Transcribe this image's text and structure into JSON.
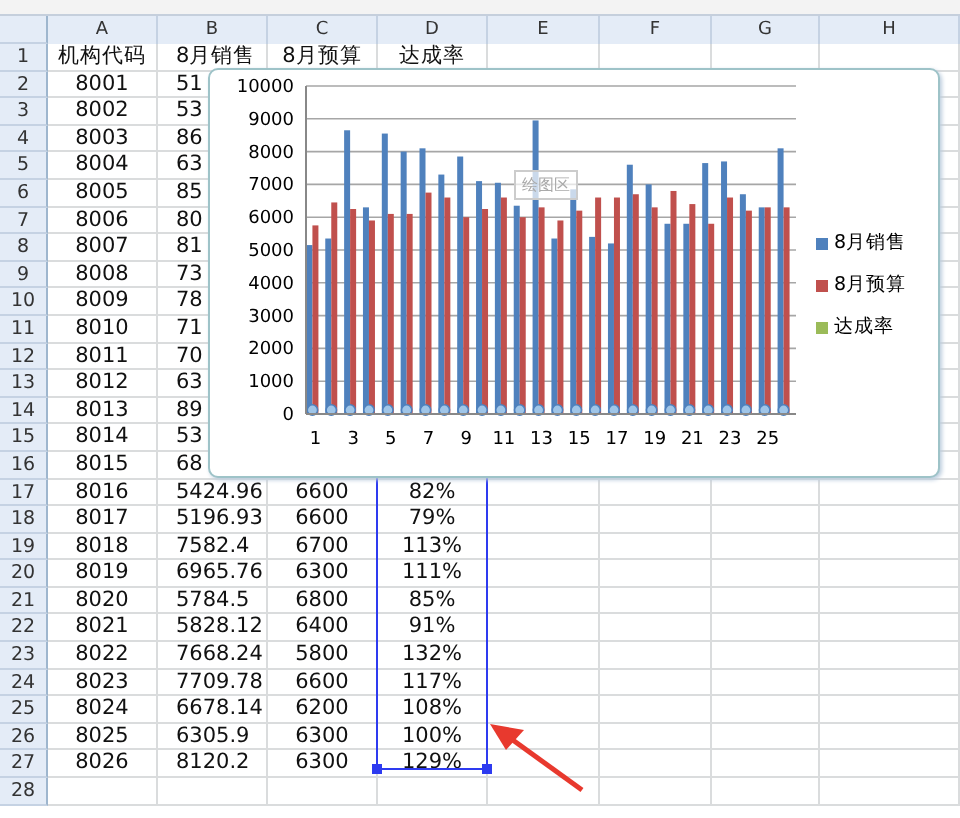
{
  "column_headers": [
    "A",
    "B",
    "C",
    "D",
    "E",
    "F",
    "G",
    "H"
  ],
  "rows": [
    {
      "num": "1",
      "cells": [
        "机构代码",
        "8月销售",
        "8月预算",
        "达成率"
      ]
    },
    {
      "num": "2",
      "cells": [
        "8001",
        "51"
      ]
    },
    {
      "num": "3",
      "cells": [
        "8002",
        "53"
      ]
    },
    {
      "num": "4",
      "cells": [
        "8003",
        "86"
      ]
    },
    {
      "num": "5",
      "cells": [
        "8004",
        "63"
      ]
    },
    {
      "num": "6",
      "cells": [
        "8005",
        "85"
      ]
    },
    {
      "num": "7",
      "cells": [
        "8006",
        "80"
      ]
    },
    {
      "num": "8",
      "cells": [
        "8007",
        "81"
      ]
    },
    {
      "num": "9",
      "cells": [
        "8008",
        "73"
      ]
    },
    {
      "num": "10",
      "cells": [
        "8009",
        "78"
      ]
    },
    {
      "num": "11",
      "cells": [
        "8010",
        "71"
      ]
    },
    {
      "num": "12",
      "cells": [
        "8011",
        "70"
      ]
    },
    {
      "num": "13",
      "cells": [
        "8012",
        "63"
      ]
    },
    {
      "num": "14",
      "cells": [
        "8013",
        "89"
      ]
    },
    {
      "num": "15",
      "cells": [
        "8014",
        "53"
      ]
    },
    {
      "num": "16",
      "cells": [
        "8015",
        "68"
      ]
    },
    {
      "num": "17",
      "cells": [
        "8016",
        "5424.96",
        "6600",
        "82%"
      ]
    },
    {
      "num": "18",
      "cells": [
        "8017",
        "5196.93",
        "6600",
        "79%"
      ]
    },
    {
      "num": "19",
      "cells": [
        "8018",
        "7582.4",
        "6700",
        "113%"
      ]
    },
    {
      "num": "20",
      "cells": [
        "8019",
        "6965.76",
        "6300",
        "111%"
      ]
    },
    {
      "num": "21",
      "cells": [
        "8020",
        "5784.5",
        "6800",
        "85%"
      ]
    },
    {
      "num": "22",
      "cells": [
        "8021",
        "5828.12",
        "6400",
        "91%"
      ]
    },
    {
      "num": "23",
      "cells": [
        "8022",
        "7668.24",
        "5800",
        "132%"
      ]
    },
    {
      "num": "24",
      "cells": [
        "8023",
        "7709.78",
        "6600",
        "117%"
      ]
    },
    {
      "num": "25",
      "cells": [
        "8024",
        "6678.14",
        "6200",
        "108%"
      ]
    },
    {
      "num": "26",
      "cells": [
        "8025",
        "6305.9",
        "6300",
        "100%"
      ]
    },
    {
      "num": "27",
      "cells": [
        "8026",
        "8120.2",
        "6300",
        "129%"
      ]
    },
    {
      "num": "28",
      "cells": []
    }
  ],
  "chart": {
    "plot_area_tooltip": "绘图区",
    "chart_data": {
      "type": "bar",
      "x": [
        1,
        2,
        3,
        4,
        5,
        6,
        7,
        8,
        9,
        10,
        11,
        12,
        13,
        14,
        15,
        16,
        17,
        18,
        19,
        20,
        21,
        22,
        23,
        24,
        25,
        26
      ],
      "grid": true,
      "series": [
        {
          "name": "8月销售",
          "color": "#4f81bd",
          "values": [
            5150,
            5350,
            8650,
            6300,
            8550,
            8000,
            8100,
            7300,
            7850,
            7100,
            7050,
            6350,
            8950,
            5350,
            6850,
            5400,
            5200,
            7600,
            7000,
            5800,
            5800,
            7650,
            7700,
            6700,
            6300,
            8100
          ]
        },
        {
          "name": "8月预算",
          "color": "#c0504d",
          "values": [
            5750,
            6450,
            6250,
            5900,
            6100,
            6100,
            6750,
            6600,
            6000,
            6250,
            6600,
            6000,
            6300,
            5900,
            6200,
            6600,
            6600,
            6700,
            6300,
            6800,
            6400,
            5800,
            6600,
            6200,
            6300,
            6300
          ]
        },
        {
          "name": "达成率",
          "color": "#9bbb59",
          "values": [
            0,
            0,
            0,
            0,
            0,
            0,
            0,
            0,
            0,
            0,
            0,
            0,
            0,
            0,
            0,
            0,
            0,
            0,
            0,
            0,
            0,
            0,
            0,
            0,
            0,
            0
          ]
        }
      ],
      "xlim": [
        0.5,
        26.5
      ],
      "ylim": [
        0,
        10000
      ],
      "yticks": [
        0,
        1000,
        2000,
        3000,
        4000,
        5000,
        6000,
        7000,
        8000,
        9000,
        10000
      ],
      "xticks": [
        1,
        3,
        5,
        7,
        9,
        11,
        13,
        15,
        17,
        19,
        21,
        23,
        25
      ]
    }
  }
}
